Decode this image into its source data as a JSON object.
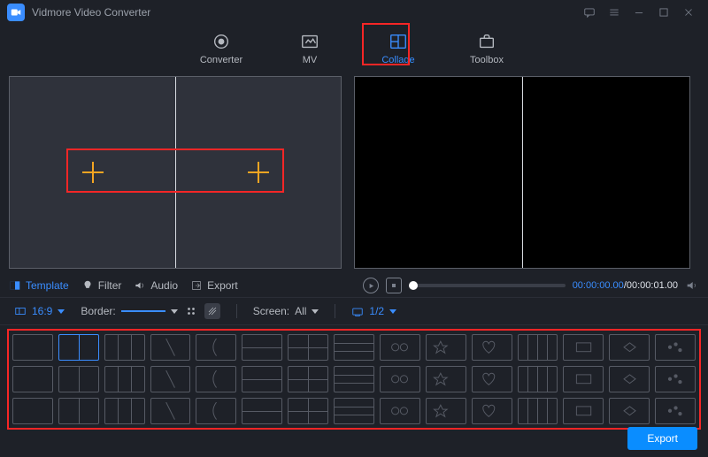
{
  "app": {
    "title": "Vidmore Video Converter"
  },
  "topnav": {
    "items": [
      {
        "label": "Converter"
      },
      {
        "label": "MV"
      },
      {
        "label": "Collage"
      },
      {
        "label": "Toolbox"
      }
    ],
    "active_index": 2
  },
  "midtabs": {
    "items": [
      {
        "label": "Template"
      },
      {
        "label": "Filter"
      },
      {
        "label": "Audio"
      },
      {
        "label": "Export"
      }
    ],
    "active_index": 0
  },
  "playback": {
    "current": "00:00:00.00",
    "total": "00:00:01.00"
  },
  "settings": {
    "aspect_ratio": "16:9",
    "border_label": "Border:",
    "screen_label": "Screen:",
    "screen_value": "All",
    "page": "1/2"
  },
  "export_button": "Export",
  "templates": {
    "selected_index": 1,
    "count": 45
  },
  "colors": {
    "accent": "#3a8dff",
    "highlight_red": "#f62626",
    "plus_orange": "#f4a522"
  }
}
